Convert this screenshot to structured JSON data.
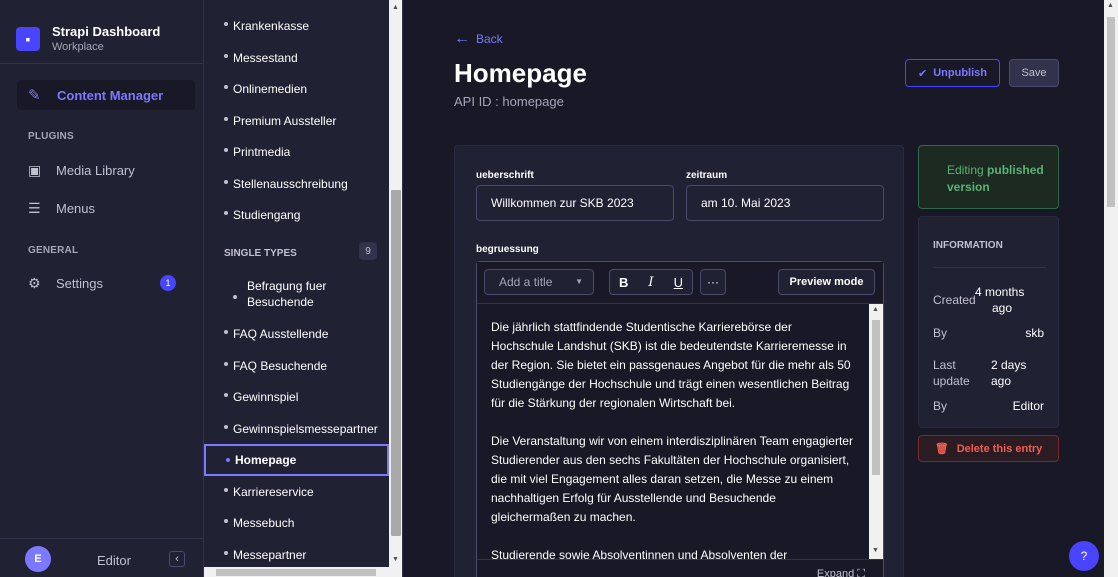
{
  "brand": {
    "title": "Strapi Dashboard",
    "subtitle": "Workplace",
    "logo_icon": "strapi-logo"
  },
  "nav": {
    "active": {
      "label": "Content Manager",
      "icon": "pen-icon"
    },
    "plugins_heading": "PLUGINS",
    "plugins": [
      {
        "label": "Media Library",
        "icon": "image-icon"
      },
      {
        "label": "Menus",
        "icon": "menu-lines-icon"
      }
    ],
    "general_heading": "GENERAL",
    "general": [
      {
        "label": "Settings",
        "icon": "gear-icon",
        "badge": "1"
      }
    ],
    "user": {
      "initial": "E",
      "name": "Editor"
    },
    "collapse_glyph": "‹"
  },
  "subnav": {
    "collection_items": [
      "Krankenkasse",
      "Messestand",
      "Onlinemedien",
      "Premium Aussteller",
      "Printmedia",
      "Stellenausschreibung",
      "Studiengang"
    ],
    "single_types_heading": "SINGLE TYPES",
    "single_types_count": "9",
    "single_items": [
      "Befragung fuer Besuchende",
      "FAQ Ausstellende",
      "FAQ Besuchende",
      "Gewinnspiel",
      "Gewinnspielsmessepartner",
      "Homepage",
      "Karriereservice",
      "Messebuch",
      "Messepartner"
    ],
    "selected": "Homepage"
  },
  "header": {
    "back_label": "Back",
    "title": "Homepage",
    "api_id": "API ID : homepage",
    "unpublish_label": "Unpublish",
    "save_label": "Save"
  },
  "form": {
    "ueberschrift_label": "ueberschrift",
    "ueberschrift_value": "Willkommen zur SKB 2023",
    "zeitraum_label": "zeitraum",
    "zeitraum_value": "am 10. Mai 2023",
    "begruessung_label": "begruessung",
    "toolbar": {
      "title_placeholder": "Add a title",
      "bold": "B",
      "italic": "I",
      "underline": "U",
      "more": "···",
      "preview_label": "Preview mode"
    },
    "paragraphs": [
      "Die jährlich stattfindende Studentische Karrierebörse der Hochschule Landshut (SKB) ist die bedeutendste Karrieremesse in der Region. Sie bietet ein passgenaues Angebot für die mehr als 50 Studiengänge der Hochschule und trägt einen wesentlichen Beitrag für die Stärkung der regionalen Wirtschaft bei.",
      "Die Veranstaltung wir von einem interdisziplinären Team engagierter Studierender aus den sechs Fakultäten der Hochschule organisiert, die mit viel Engagement alles daran setzen, die Messe zu einem nachhaltigen Erfolg für Ausstellende und Besuchende gleichermaßen zu machen.",
      "Studierende sowie Absolventinnen und Absolventen der"
    ],
    "expand_label": "Expand ⛶"
  },
  "sidebar": {
    "status_prefix": "Editing ",
    "status_strong": "published",
    "status_suffix": "version",
    "info_heading": "INFORMATION",
    "created_key": "Created",
    "created_val_1": "4 months",
    "created_val_2": "ago",
    "by_key": "By",
    "by_val": "skb",
    "last_update_key_1": "Last",
    "last_update_key_2": "update",
    "last_update_val_1": "2 days",
    "last_update_val_2": "ago",
    "by2_key": "By",
    "by2_val": "Editor",
    "delete_label": "Delete this entry"
  },
  "help": {
    "label": "?"
  },
  "colors": {
    "primary": "#4945ff",
    "primary_light": "#7b79ff",
    "success": "#5cb176",
    "danger": "#ee5e52",
    "bg": "#181826",
    "panel": "#212134"
  }
}
